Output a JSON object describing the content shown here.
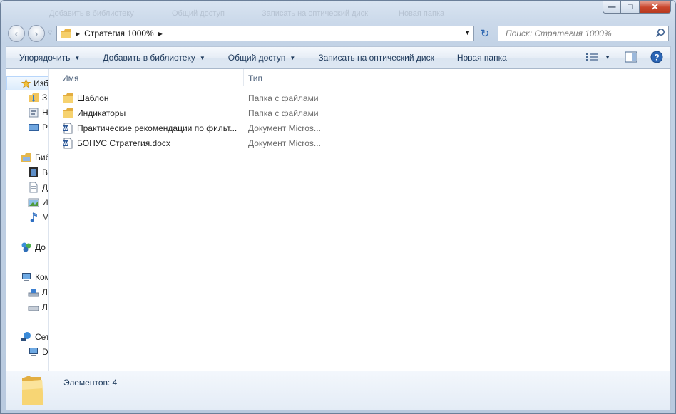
{
  "window": {
    "ghost_titles": [
      "Добавить в библиотеку",
      "Общий доступ",
      "Записать на оптический диск",
      "Новая папка"
    ],
    "min_glyph": "—",
    "max_glyph": "□",
    "close_glyph": "✕"
  },
  "address": {
    "breadcrumb": "Стратегия 1000%",
    "separator": "▶",
    "dropdown": "▼",
    "refresh_glyph": "↻"
  },
  "search": {
    "placeholder": "Поиск: Стратегия 1000%"
  },
  "toolbar": {
    "organize": "Упорядочить",
    "add_to_library": "Добавить в библиотеку",
    "share": "Общий доступ",
    "burn": "Записать на оптический диск",
    "new_folder": "Новая папка",
    "arrow": "▼"
  },
  "columns": {
    "name": "Имя",
    "type": "Тип"
  },
  "files": [
    {
      "name": "Шаблон",
      "type": "Папка с файлами",
      "icon": "folder-icon"
    },
    {
      "name": "Индикаторы",
      "type": "Папка с файлами",
      "icon": "folder-icon"
    },
    {
      "name": "Практические рекомендации по фильт...",
      "type": "Документ Micros...",
      "icon": "word-doc-icon"
    },
    {
      "name": "БОНУС Стратегия.docx",
      "type": "Документ Micros...",
      "icon": "word-doc-icon"
    }
  ],
  "nav": {
    "favorites": "Изб",
    "item_z": "З",
    "item_n": "Н",
    "item_r": "Р",
    "libraries": "Биб",
    "lib_video": "В",
    "lib_docs": "Д",
    "lib_images": "И",
    "lib_music": "М",
    "homegroup": "До",
    "computer": "Ком",
    "drive_l1": "Л",
    "drive_l2": "Л",
    "network": "Сет",
    "net_d": "D"
  },
  "status": {
    "count": "Элементов: 4"
  },
  "colors": {
    "accent": "#1e395b",
    "selection": "#dcecfc",
    "folder": "#f2c55c"
  }
}
